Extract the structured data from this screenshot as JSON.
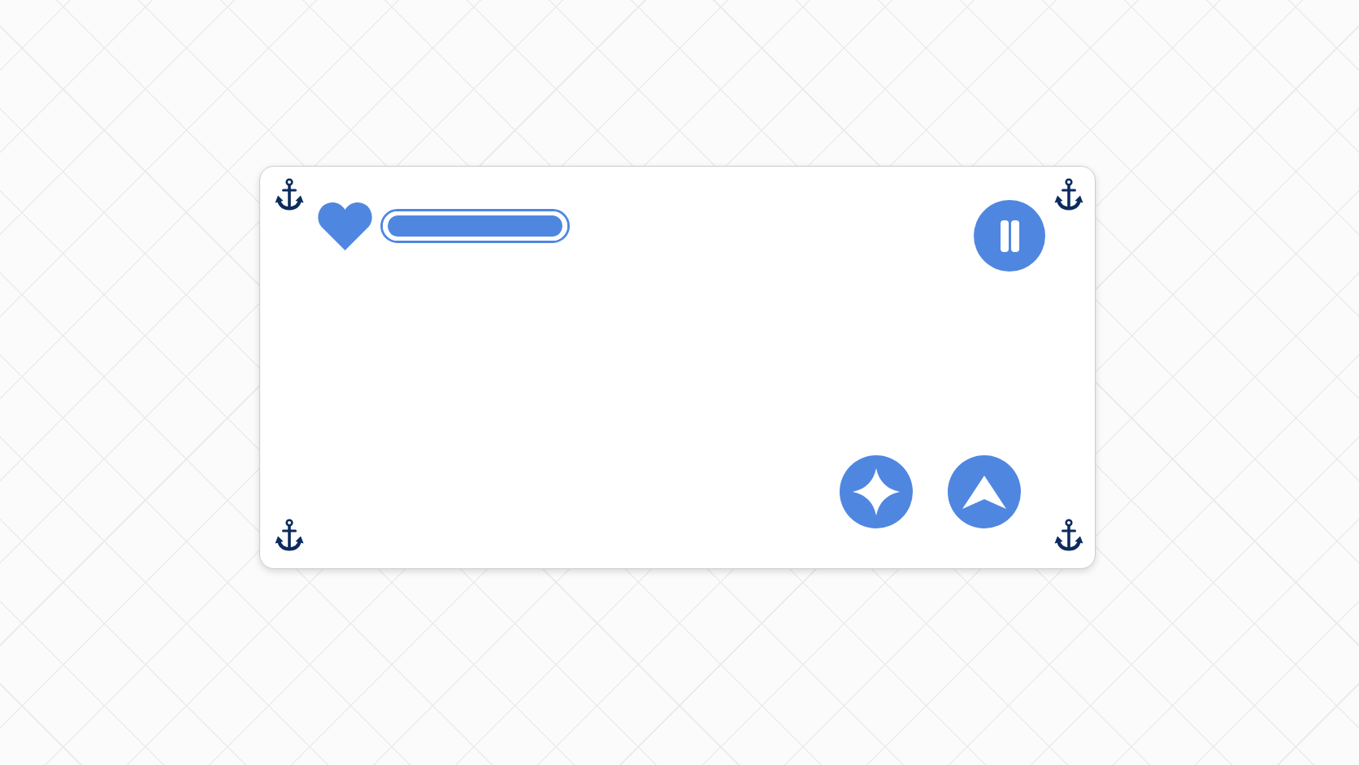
{
  "health_bar": {
    "level": 1
  },
  "menu_button": {
    "kind": "pause"
  },
  "action_buttons": [
    {
      "kind": "sparkle"
    },
    {
      "kind": "arrow"
    }
  ]
}
